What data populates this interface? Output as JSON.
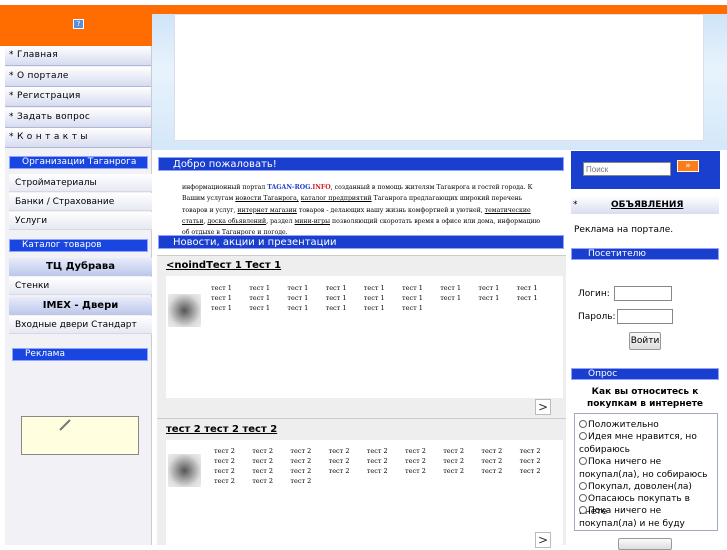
{
  "header": {
    "icon": "help-icon",
    "icon_glyph": "?"
  },
  "menu": [
    {
      "label": "* Главная"
    },
    {
      "label": "* О портале"
    },
    {
      "label": "* Регистрация"
    },
    {
      "label": "* Задать вопрос"
    },
    {
      "label": "* К о н т а к т ы"
    }
  ],
  "orgs": {
    "title": "Организации Таганрога",
    "items": [
      "Стройматериалы",
      "Банки / Страхование",
      "Услуги"
    ]
  },
  "catalog": {
    "title": "Каталог товаров",
    "group1_title": "ТЦ Дубрава",
    "group1_item": "Стенки",
    "group2_title": "IMEX - Двери",
    "group2_item": "Входные двери Стандарт"
  },
  "ads_left": {
    "title": "Реклама"
  },
  "welcome": {
    "title": "Добро пожаловать!",
    "t1": "информационный портал ",
    "brand1": "TAGAN-ROG.",
    "brand2": "INFO",
    "t2": ", созданный в помощь жителям    Таганрога и гостей города.   К Вашим услугам ",
    "l1": "новости Таганрога,",
    "t3": "  ",
    "l2": "каталог предприятий",
    "t4": "  Таганрога предлагающих широкий перечень товаров и услуг, ",
    "l3": "интернет магазин",
    "t5": " товаров - делающих нашу жизнь комфортней и уютней,   ",
    "l4": "тематические статьи",
    "t6": ", ",
    "l5": "доска обьявлений",
    "t7": ", раздел ",
    "l6": "мини-игры",
    "t8": " позволяющий скоротать время в офисе или дома, информацию об отдыхе в Таганроге и погоде."
  },
  "news": {
    "title": "Новости, акции и презентации",
    "items": [
      {
        "title": "<noindТест 1 Тест 1",
        "rows": [
          [
            "тест 1",
            "тест 1",
            "тест 1",
            "тест 1",
            "тест 1",
            "тест 1",
            "тест 1",
            "тест 1",
            "тест 1"
          ],
          [
            "тест 1",
            "тест 1",
            "тест 1",
            "тест 1",
            "тест 1",
            "тест 1",
            "тест 1",
            "тест 1",
            "тест 1"
          ],
          [
            "тест 1",
            "тест 1",
            "тест 1",
            "тест 1",
            "тест 1",
            "тест 1"
          ]
        ]
      },
      {
        "title": "тест 2 тест 2 тест 2",
        "rows": [
          [
            "тест 2",
            "тест 2",
            "тест 2",
            "тест 2",
            "тест 2",
            "тест 2",
            "тест 2",
            "тест 2",
            "тест 2"
          ],
          [
            "тест 2",
            "тест 2",
            "тест 2",
            "тест 2",
            "тест 2",
            "тест 2",
            "тест 2",
            "тест 2",
            "тест 2"
          ],
          [
            "тест 2",
            "тест 2",
            "тест 2",
            "тест 2",
            "тест 2",
            "тест 2",
            "тест 2",
            "тест 2",
            "тест 2"
          ],
          [
            "тест 2",
            "тест 2",
            "тест 2"
          ]
        ]
      }
    ],
    "next_glyph": ">"
  },
  "search": {
    "placeholder": "Поиск",
    "button": "»"
  },
  "announcements": {
    "prefix": "*",
    "title": "ОБЪЯВЛЕНИЯ",
    "text": "Реклама на портале."
  },
  "visitor": {
    "title": "Посетителю",
    "login_label": "Логин:",
    "password_label": "Пароль:",
    "submit": "Войти"
  },
  "poll": {
    "title": "Опрос",
    "question": "Как вы относитесь к покупкам в интернете",
    "options": [
      "Положительно",
      "Идея мне нравится, но собираюсь",
      "Пока ничего не покупал(ла), но собираюсь",
      "Покупал, доволен(ла)",
      "Опасаюсь покупать в инете",
      "Пока ничего не покупал(ла) и не буду"
    ]
  }
}
